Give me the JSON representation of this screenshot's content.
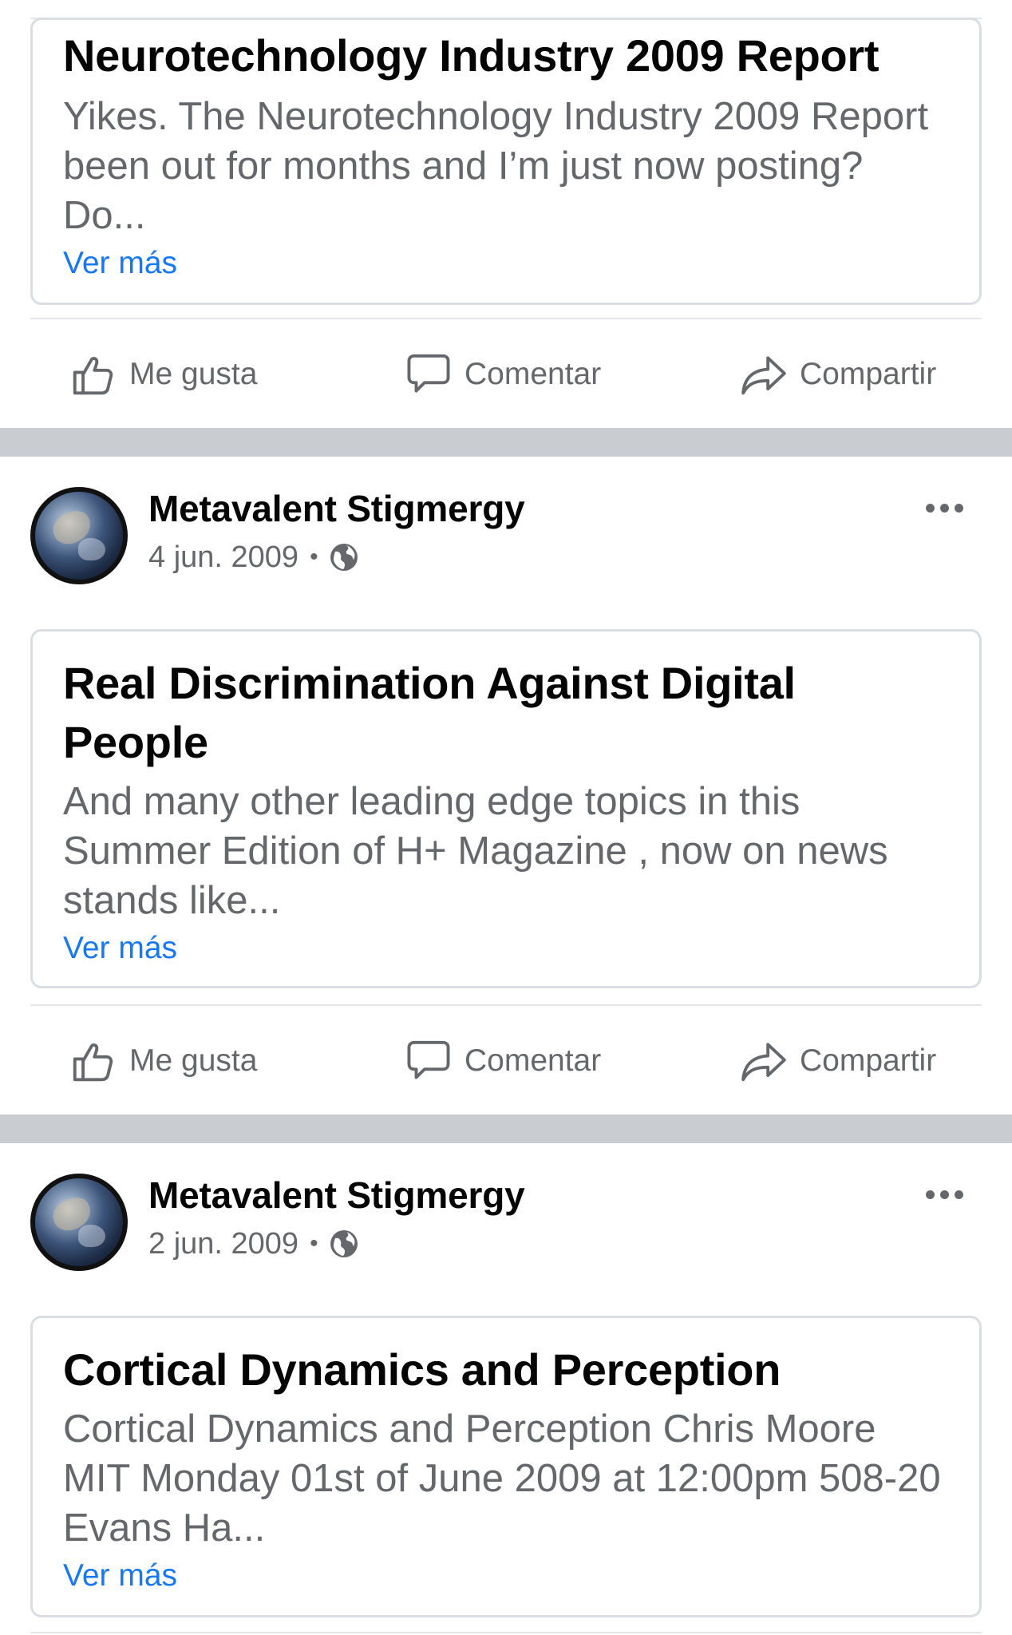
{
  "posts": [
    {
      "card": {
        "title": "Neurotechnology Industry 2009 Report",
        "text": "Yikes.  The Neurotechnology Industry 2009 Report  been out for months and I’m just now posting? Do...",
        "see_more": "Ver más"
      },
      "actions": {
        "like": "Me gusta",
        "comment": "Comentar",
        "share": "Compartir"
      }
    },
    {
      "author": "Metavalent Stigmergy",
      "date": "4 jun. 2009",
      "separator": "•",
      "card": {
        "title": "Real Discrimination Against Digital People",
        "text": "And many other leading edge topics in this Summer Edition of H+ Magazine , now on news stands like...",
        "see_more": "Ver más"
      },
      "actions": {
        "like": "Me gusta",
        "comment": "Comentar",
        "share": "Compartir"
      }
    },
    {
      "author": "Metavalent Stigmergy",
      "date": "2 jun. 2009",
      "separator": "•",
      "card": {
        "title": "Cortical Dynamics and Perception",
        "text": "Cortical Dynamics and Perception Chris Moore MIT Monday 01st of June 2009 at 12:00pm 508-20 Evans Ha...",
        "see_more": "Ver más"
      }
    }
  ],
  "icons": {
    "like": "thumbs-up-icon",
    "comment": "speech-bubble-icon",
    "share": "share-arrow-icon",
    "audience": "globe-icon",
    "options": "more-options-icon"
  },
  "colors": {
    "link": "#1877f2",
    "secondary_text": "#65676b",
    "primary_text": "#050505",
    "feed_divider": "#c9ccd1",
    "card_border": "#dadde1"
  }
}
